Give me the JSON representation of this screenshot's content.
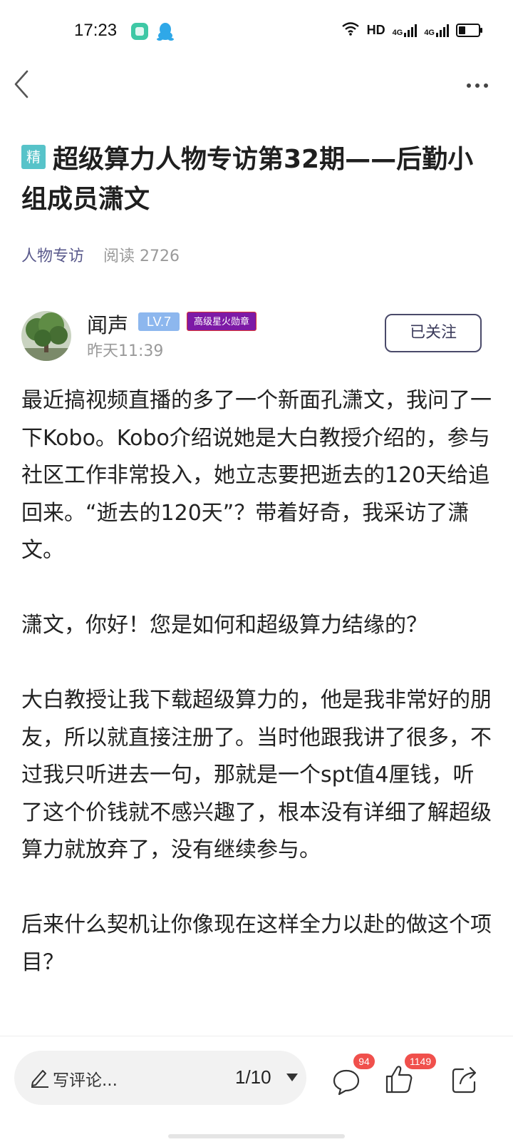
{
  "status_bar": {
    "time": "17:23",
    "network": "HD",
    "signal_1": "4G",
    "signal_2": "4G"
  },
  "post": {
    "badge": "精",
    "title": "超级算力人物专访第32期——后勤小组成员潇文",
    "category": "人物专访",
    "reads": "阅读 2726"
  },
  "author": {
    "name": "闻声",
    "level": "LV.7",
    "medal": "高级星火勋章",
    "time": "昨天11:39",
    "follow_label": "已关注"
  },
  "content": {
    "paragraphs": [
      "最近搞视频直播的多了一个新面孔潇文，我问了一下Kobo。Kobo介绍说她是大白教授介绍的，参与社区工作非常投入，她立志要把逝去的120天给追回来。“逝去的120天”？带着好奇，我采访了潇文。",
      "潇文，你好！您是如何和超级算力结缘的？",
      "大白教授让我下载超级算力的，他是我非常好的朋友，所以就直接注册了。当时他跟我讲了很多，不过我只听进去一句，那就是一个spt值4厘钱，听了这个价钱就不感兴趣了，根本没有详细了解超级算力就放弃了，没有继续参与。",
      "后来什么契机让你像现在这样全力以赴的做这个项目？"
    ]
  },
  "bottom_bar": {
    "comment_placeholder": "写评论...",
    "page": "1/10",
    "comment_count": "94",
    "like_count": "1149"
  }
}
